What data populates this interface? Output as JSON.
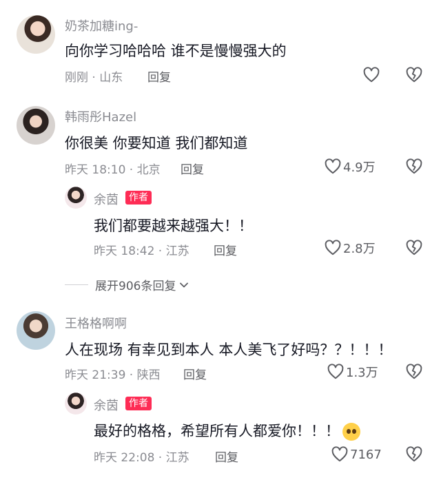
{
  "comments": [
    {
      "name": "奶茶加糖ing-",
      "text": "向你学习哈哈哈  谁不是慢慢强大的",
      "time_loc": "刚刚 · 山东",
      "reply": "回复",
      "likes": ""
    },
    {
      "name": "韩雨彤Hazel",
      "text": "你很美 你要知道 我们都知道",
      "time_loc": "昨天 18:10 · 北京",
      "reply": "回复",
      "likes": "4.9万"
    },
    {
      "name": "王格格啊啊",
      "text": "人在现场 有幸见到本人 本人美飞了好吗？？！！！",
      "time_loc": "昨天 21:39 · 陕西",
      "reply": "回复",
      "likes": "1.3万"
    }
  ],
  "replies": [
    {
      "name": "余茵",
      "badge": "作者",
      "text": "我们都要越来越强大！！",
      "time_loc": "昨天 18:42 · 江苏",
      "reply": "回复",
      "likes": "2.8万"
    },
    {
      "name": "余茵",
      "badge": "作者",
      "text": "最好的格格，希望所有人都爱你！！！",
      "time_loc": "昨天 22:08 · 江苏",
      "reply": "回复",
      "likes": "7167"
    }
  ],
  "expand": {
    "label": "展开906条回复"
  },
  "icons": {
    "like": "heart-outline-icon",
    "dislike": "broken-heart-icon",
    "expand": "chevron-down-icon",
    "emoji": "pleading-face-emoji"
  }
}
